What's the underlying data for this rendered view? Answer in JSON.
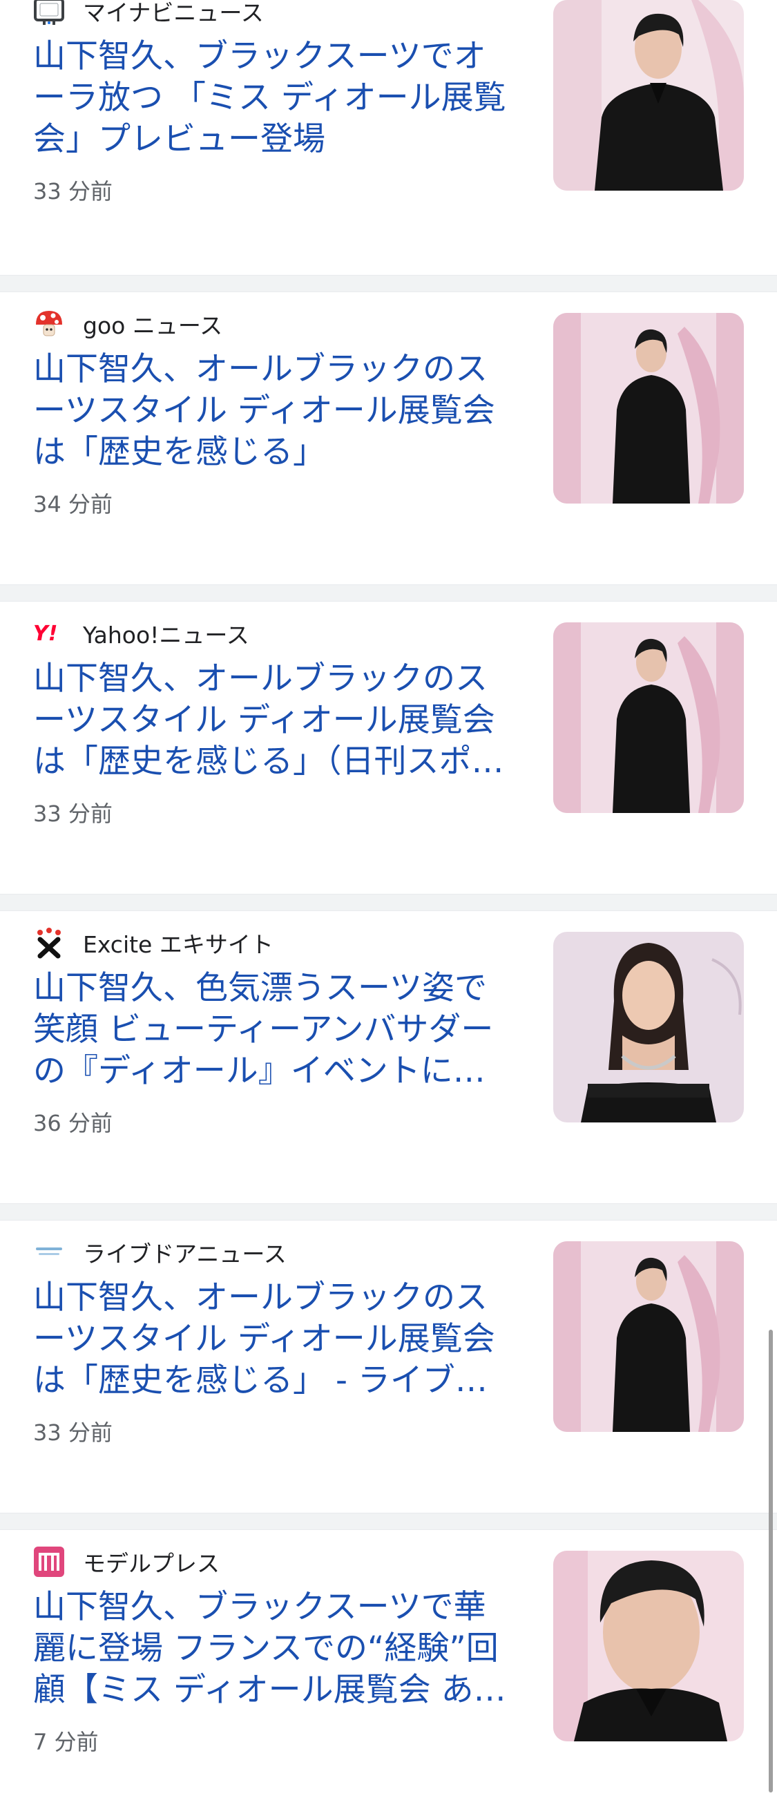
{
  "articles": [
    {
      "source": "マイナビニュース",
      "source_icon": "tv-icon",
      "headline": "山下智久、ブラックスーツでオーラ放つ 「ミス ディオール展覧会」プレビュー登場",
      "time": "33 分前",
      "thumbnail": "man-black-suit-pink-background"
    },
    {
      "source": "goo ニュース",
      "source_icon": "goo-mushroom-icon",
      "headline": "山下智久、オールブラックのスーツスタイル ディオール展覧会は「歴史を感じる」",
      "time": "34 分前",
      "thumbnail": "man-black-suit-pink-background"
    },
    {
      "source": "Yahoo!ニュース",
      "source_icon": "yahoo-icon",
      "headline": "山下智久、オールブラックのスーツスタイル ディオール展覧会は「歴史を感じる」（日刊スポーツ）",
      "time": "33 分前",
      "thumbnail": "man-black-suit-pink-background"
    },
    {
      "source": "Excite エキサイト",
      "source_icon": "excite-icon",
      "headline": "山下智久、色気漂うスーツ姿で笑顔 ビューティーアンバサダーの『ディオール』イベントに登場",
      "time": "36 分前",
      "thumbnail": "woman-black-dress-necklace"
    },
    {
      "source": "ライブドアニュース",
      "source_icon": "livedoor-icon",
      "headline": "山下智久、オールブラックのスーツスタイル ディオール展覧会は「歴史を感じる」 - ライブドアニュース",
      "time": "33 分前",
      "thumbnail": "man-black-suit-pink-background"
    },
    {
      "source": "モデルプレス",
      "source_icon": "modelpress-icon",
      "headline": "山下智久、ブラックスーツで華麗に登場 フランスでの“経験”回顧【ミス ディオール展覧会 あなたは恋をしている】",
      "time": "7 分前",
      "thumbnail": "man-portrait-closeup"
    }
  ],
  "colors": {
    "headline": "#1a4fb0",
    "source": "#202124",
    "time": "#5f6368",
    "separator": "#f1f3f4"
  }
}
